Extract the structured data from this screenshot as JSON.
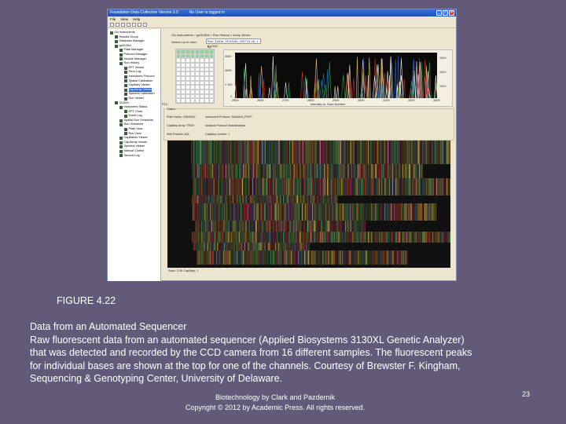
{
  "window": {
    "title": "Foundation Data Collection Version 3.0",
    "user": "No User is logged in",
    "min": "_",
    "max": "□",
    "close": "✕"
  },
  "menu": [
    "File",
    "View",
    "Help"
  ],
  "tree": [
    {
      "label": "GA Instruments",
      "lvl": 0
    },
    {
      "label": "Results Group",
      "lvl": 1
    },
    {
      "label": "Database Manager",
      "lvl": 1
    },
    {
      "label": "ga3130xl",
      "lvl": 1
    },
    {
      "label": "Plate Manager",
      "lvl": 2
    },
    {
      "label": "Protocol Manager",
      "lvl": 2
    },
    {
      "label": "Module Manager",
      "lvl": 2
    },
    {
      "label": "Run History",
      "lvl": 2
    },
    {
      "label": "EPT Viewer",
      "lvl": 3
    },
    {
      "label": "Error Log",
      "lvl": 3
    },
    {
      "label": "Instrument Protocol",
      "lvl": 3
    },
    {
      "label": "Spatial Calibration",
      "lvl": 3
    },
    {
      "label": "Capillary Viewer",
      "lvl": 3
    },
    {
      "label": "Cap/Array Viewer",
      "lvl": 3,
      "selected": true
    },
    {
      "label": "Spectral Calibration",
      "lvl": 3
    },
    {
      "label": "Run Viewer",
      "lvl": 3
    },
    {
      "label": "3130XL",
      "lvl": 1
    },
    {
      "label": "Instrument Status",
      "lvl": 2
    },
    {
      "label": "EPT Chart",
      "lvl": 3
    },
    {
      "label": "Event Log",
      "lvl": 3
    },
    {
      "label": "Spatial Run Scheduler",
      "lvl": 2
    },
    {
      "label": "Run Scheduler",
      "lvl": 2
    },
    {
      "label": "Plate View",
      "lvl": 3
    },
    {
      "label": "Run View",
      "lvl": 3
    },
    {
      "label": "Capillaries Viewer",
      "lvl": 2
    },
    {
      "label": "Cap/Array Viewer",
      "lvl": 2
    },
    {
      "label": "Spectral Viewer",
      "lvl": 2
    },
    {
      "label": "Manual Control",
      "lvl": 2
    },
    {
      "label": "Service Log",
      "lvl": 2
    }
  ],
  "content": {
    "breadcrumb": "GA Instruments > ga3130xl > Run History > Array Viewer",
    "select_label": "Select run to view:",
    "select_value": "Run_3130xl_SCH1150_2007-01-16_1 - 6_0100",
    "grid_top": "B1",
    "grid_bottom": "P12",
    "chart": {
      "y_left": [
        "3000",
        "2000",
        "1 100",
        "0"
      ],
      "y_right": [
        "1510",
        "1510",
        "1510"
      ],
      "x": [
        "2500",
        "2600",
        "2700",
        "2800",
        "2900",
        "3000",
        "3100",
        "3200",
        "3300"
      ],
      "xlabel": "Intensity vs. Scan Number"
    },
    "status": {
      "legend": "Status",
      "rows": [
        [
          "Plate Name: 02640047",
          "Instrument Protocol: Std2xIle3_POP7"
        ],
        [
          "Capillary Array: TRSH",
          "Analysis Protocol: BaseAnalysis"
        ],
        [
          "Well Position: A01",
          "Capillary number: 1"
        ]
      ]
    },
    "footer": "Scan: 3 00  Capillary: 1"
  },
  "slide": {
    "figure": "FIGURE 4.22",
    "caption_lines": [
      "Data from an Automated Sequencer",
      "Raw fluorescent data from an automated sequencer (Applied Biosystems 3130XL Genetic Analyzer)",
      "that was detected and recorded by the CCD camera from 16 different samples. The fluorescent peaks",
      "for individual bases are shown at the top for one of the channels. Courtesy of Brewster F. Kingham,",
      "Sequencing & Genotyping Center, University of Delaware."
    ],
    "credit1": "Biotechnology by Clark and Pazdernik",
    "credit2": "Copyright © 2012 by Academic Press. All rights reserved.",
    "page": "23"
  },
  "colors": {
    "bg": "#625a78",
    "peaks": [
      "#e0c060",
      "#d03030",
      "#30a050",
      "#e8e8e8",
      "#3060c0"
    ]
  }
}
